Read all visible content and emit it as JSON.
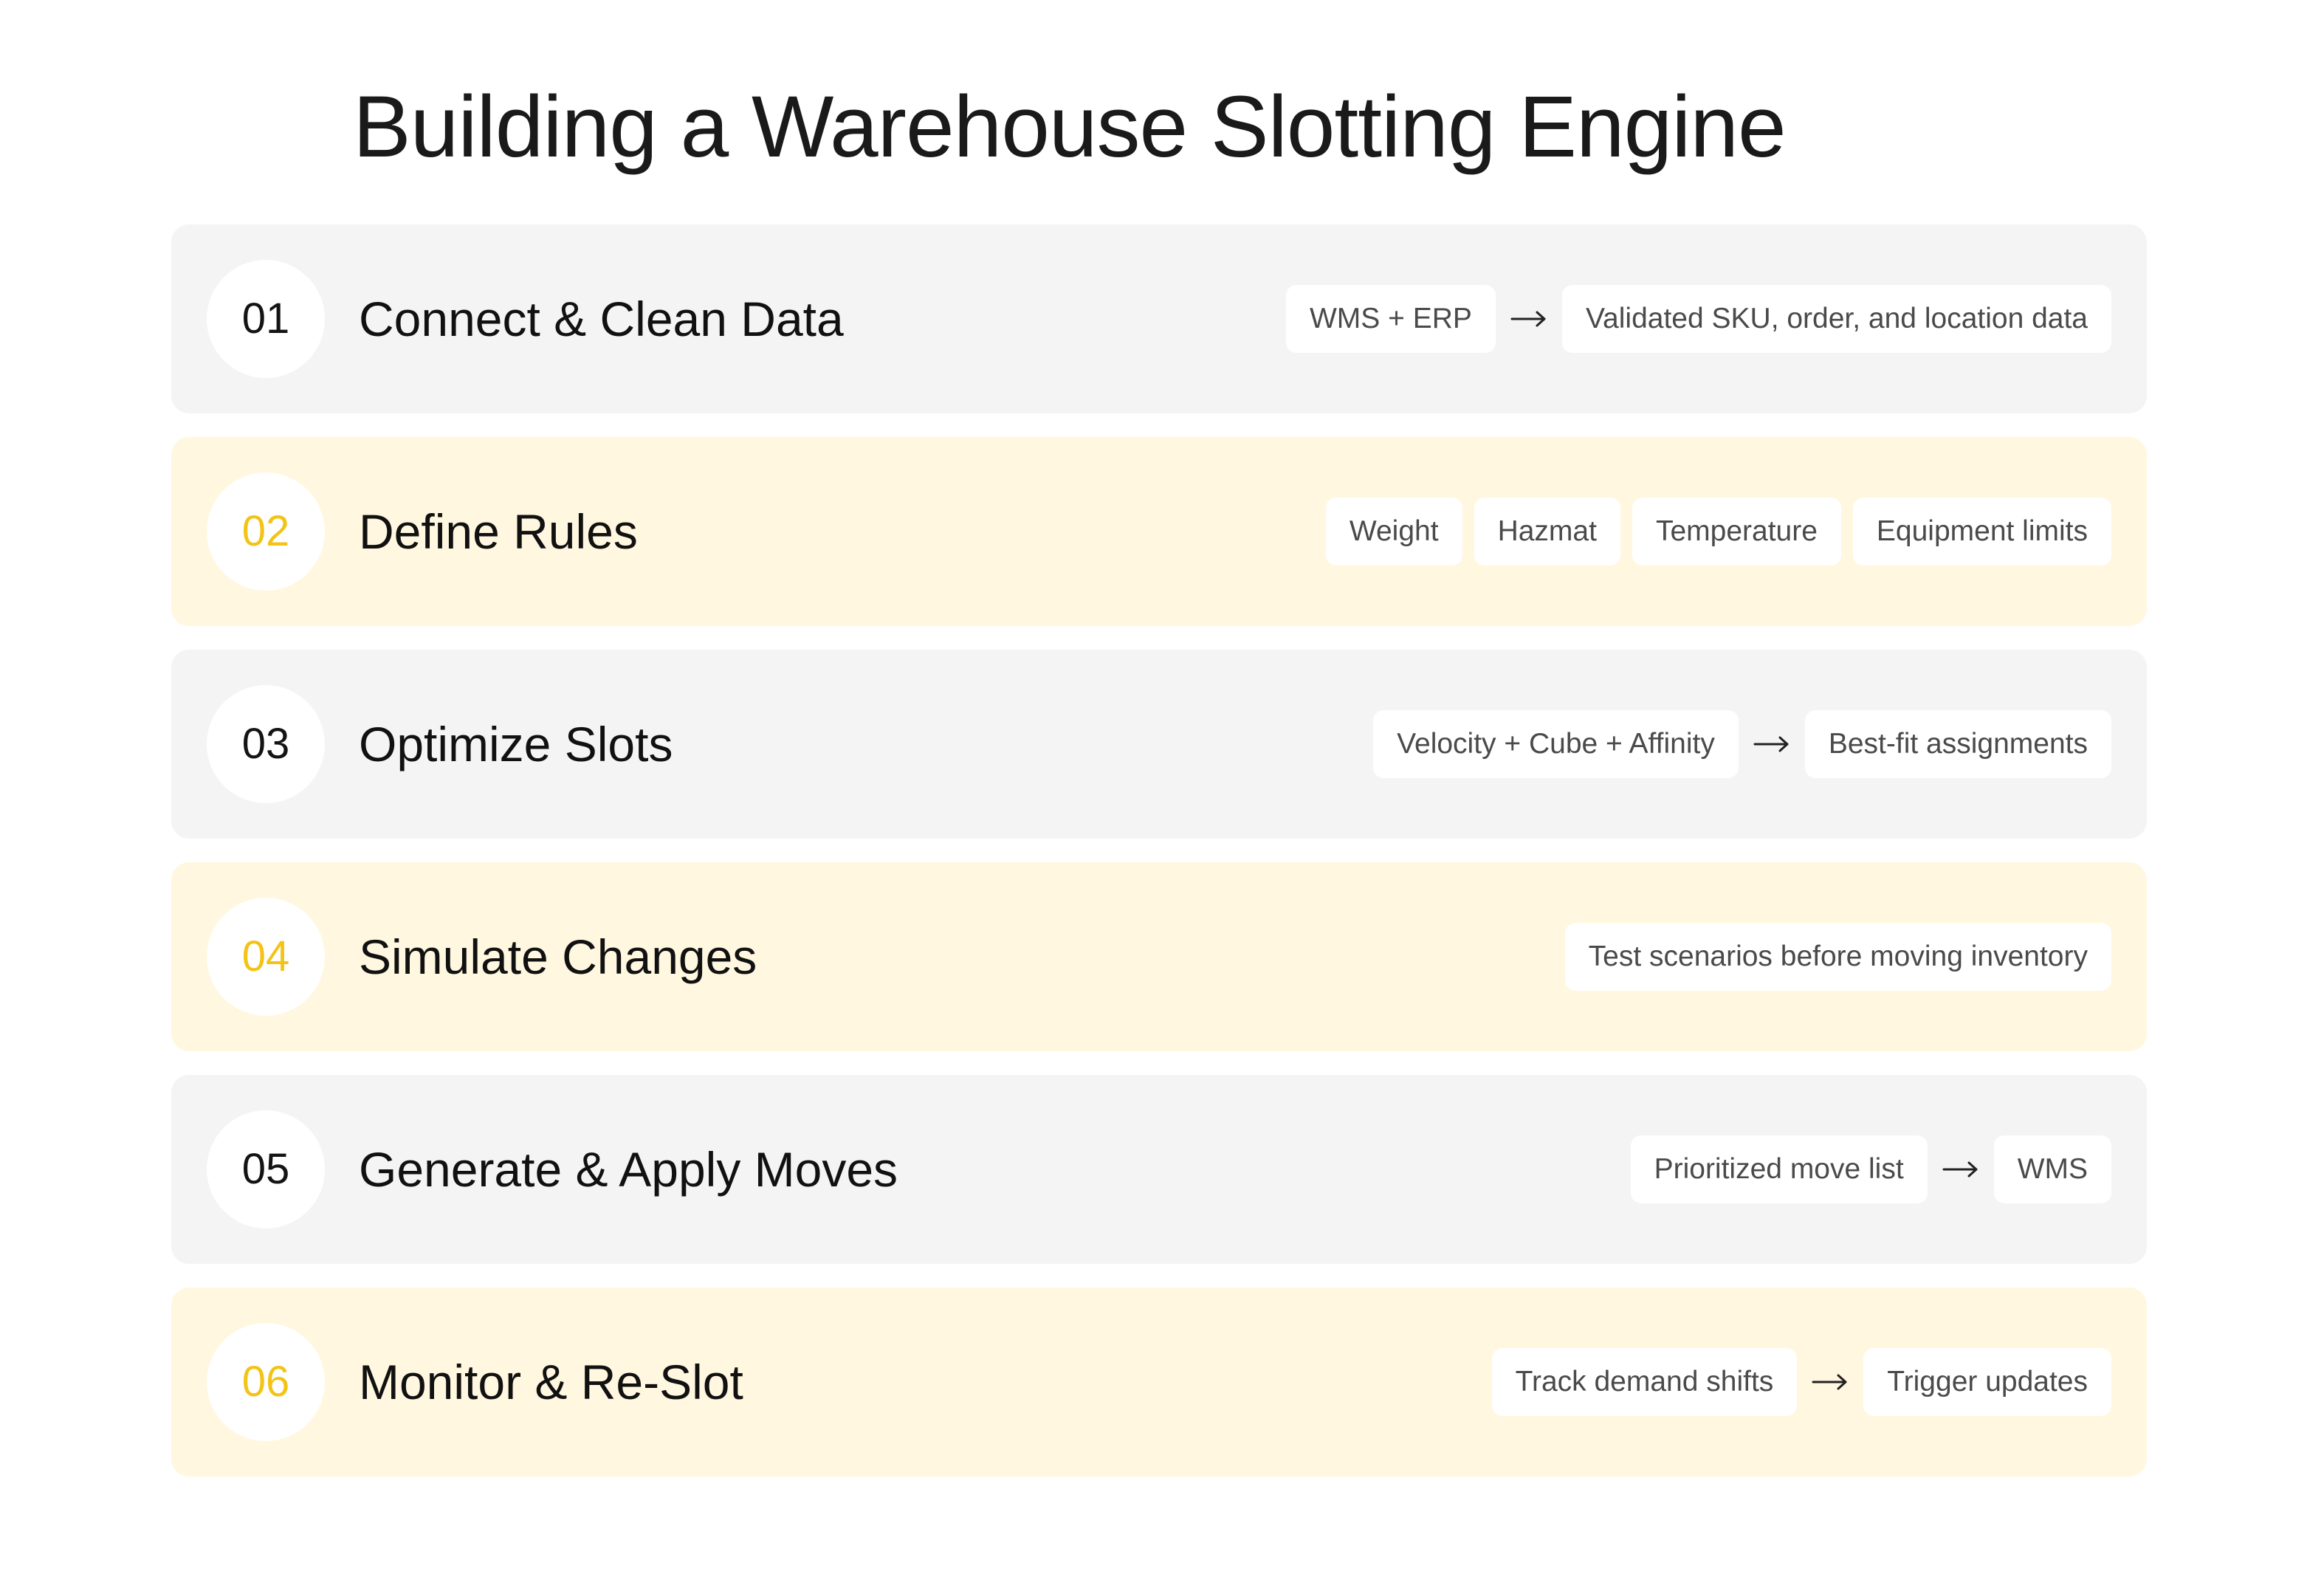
{
  "title": "Building a Warehouse Slotting Engine",
  "colors": {
    "row_gray": "#f4f4f4",
    "row_yellow": "#fff7df",
    "accent_number": "#f3c316",
    "chip_bg": "#ffffff",
    "chip_text": "#4a4a4a"
  },
  "steps": [
    {
      "number": "01",
      "title": "Connect & Clean Data",
      "chips": [
        "WMS + ERP",
        "Validated SKU, order, and location data"
      ],
      "flow": true
    },
    {
      "number": "02",
      "title": "Define Rules",
      "chips": [
        "Weight",
        "Hazmat",
        "Temperature",
        "Equipment limits"
      ],
      "flow": false
    },
    {
      "number": "03",
      "title": "Optimize Slots",
      "chips": [
        "Velocity + Cube + Affinity",
        "Best-fit assignments"
      ],
      "flow": true
    },
    {
      "number": "04",
      "title": "Simulate Changes",
      "chips": [
        "Test scenarios before moving inventory"
      ],
      "flow": false
    },
    {
      "number": "05",
      "title": "Generate & Apply Moves",
      "chips": [
        "Prioritized move list",
        "WMS"
      ],
      "flow": true
    },
    {
      "number": "06",
      "title": "Monitor & Re-Slot",
      "chips": [
        "Track demand shifts",
        "Trigger updates"
      ],
      "flow": true
    }
  ]
}
